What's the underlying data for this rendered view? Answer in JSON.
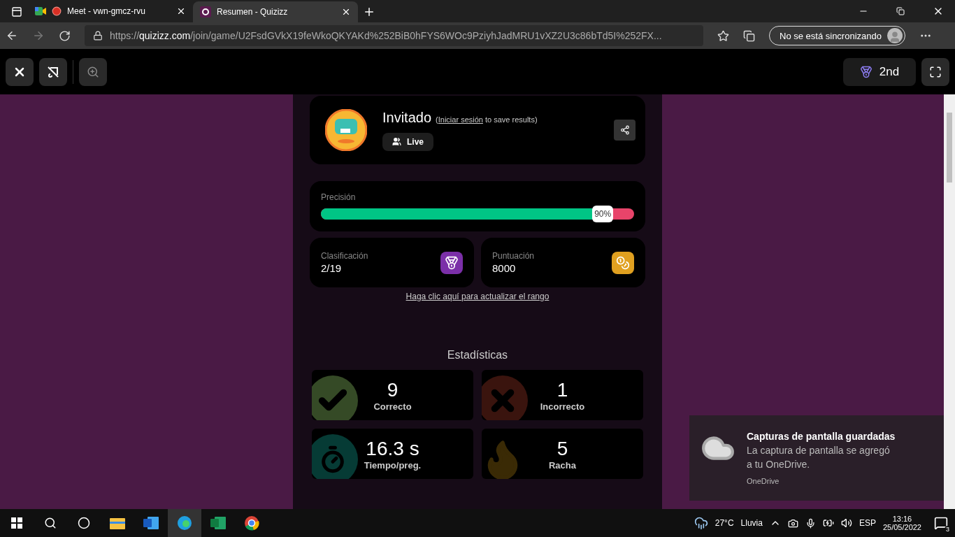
{
  "browser": {
    "tabs": [
      {
        "title": "Meet - vwn-gmcz-rvu",
        "kind": "meet",
        "selected": false
      },
      {
        "title": "Resumen - Quizizz",
        "kind": "quiz",
        "selected": true
      }
    ],
    "url": {
      "scheme": "https://",
      "domain": "quizizz.com",
      "path": "/join/game/U2FsdGVkX19feWkoQKYAKd%252BiB0hFYS6WOc9PziyhJadMRU1vXZ2U3c86bTd5I%252FX..."
    },
    "profile": "No se está sincronizando"
  },
  "game_toolbar": {
    "rank": "2nd"
  },
  "player": {
    "name": "Invitado",
    "login_note": {
      "before": "(",
      "link": "Iniciar sesión",
      "after": " to save results)"
    },
    "mode": "Live"
  },
  "accuracy": {
    "label": "Precisión",
    "level": 0.9,
    "reading": "90%"
  },
  "cards": [
    {
      "kind": "rank",
      "label": "Clasificación",
      "value": "2/19"
    },
    {
      "kind": "score",
      "label": "Puntuación",
      "value": "8000"
    }
  ],
  "update_link": "Haga clic aquí para actualizar el rango",
  "stats": {
    "title": "Estadísticas",
    "items": [
      {
        "kind": "correct",
        "value": "9",
        "label": "Correcto"
      },
      {
        "kind": "incorrect",
        "value": "1",
        "label": "Incorrecto"
      },
      {
        "kind": "time",
        "value": "16.3 s",
        "label": "Tiempo/preg."
      },
      {
        "kind": "streak",
        "value": "5",
        "label": "Racha"
      }
    ]
  },
  "notification": {
    "title": "Capturas de pantalla guardadas",
    "body": "La captura de pantalla se agregó a tu OneDrive.",
    "source": "OneDrive"
  },
  "taskbar": {
    "temperature": "27°C",
    "weather": "Lluvia",
    "language": "ESP",
    "time": "13:16",
    "date": "25/05/2022",
    "notification_count": "3"
  }
}
